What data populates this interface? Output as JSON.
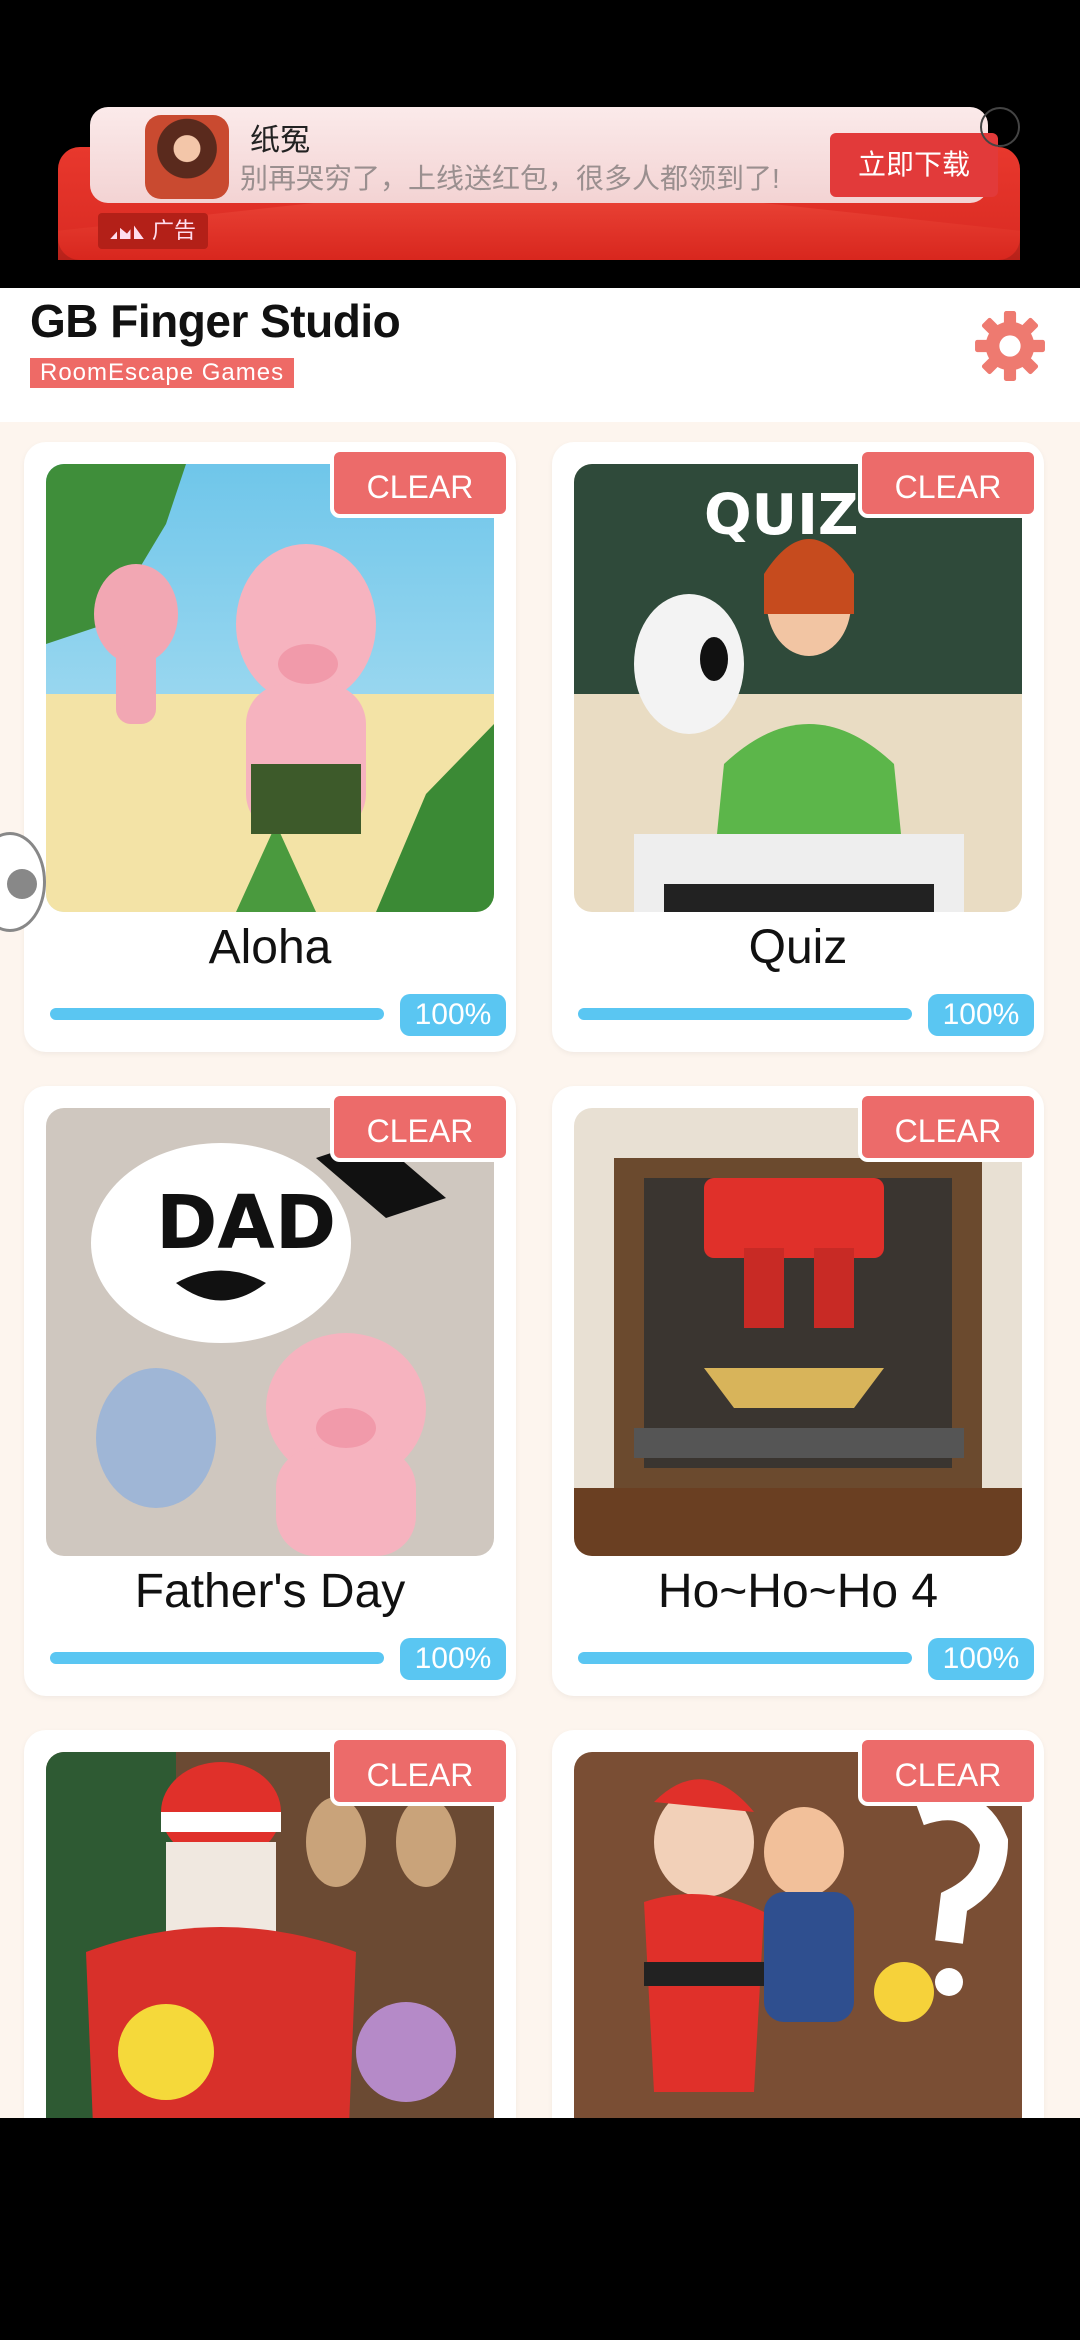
{
  "ad": {
    "name": "纸冤",
    "desc": "别再哭穷了，上线送红包，很多人都领到了!",
    "button": "立即下载",
    "tag": "广告"
  },
  "header": {
    "title": "GB Finger Studio",
    "subtitle": "RoomEscape  Games"
  },
  "games": [
    {
      "title": "Aloha",
      "badge": "CLEAR",
      "progress": "100%"
    },
    {
      "title": "Quiz",
      "badge": "CLEAR",
      "progress": "100%"
    },
    {
      "title": "Father's Day",
      "badge": "CLEAR",
      "progress": "100%"
    },
    {
      "title": "Ho~Ho~Ho 4",
      "badge": "CLEAR",
      "progress": "100%"
    },
    {
      "title": "",
      "badge": "CLEAR",
      "progress": ""
    },
    {
      "title": "",
      "badge": "CLEAR",
      "progress": ""
    }
  ],
  "thumb_text": {
    "quiz": "QUIZ",
    "dad": "DAD"
  },
  "colors": {
    "clear_badge": "#ec6b6a",
    "progress": "#5ac6f2",
    "accent": "#ee6a66"
  }
}
